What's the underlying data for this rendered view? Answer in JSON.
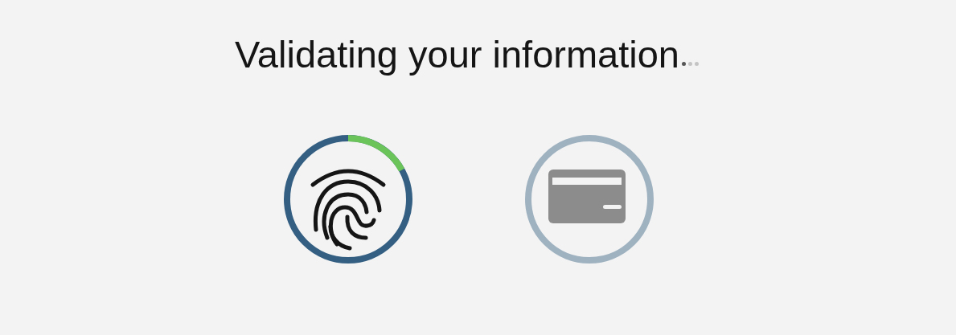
{
  "title": "Validating your information",
  "loading_dots": [
    {
      "selected": true
    },
    {
      "selected": false
    },
    {
      "selected": false
    }
  ],
  "steps": [
    {
      "kind": "fingerprint",
      "active": true
    },
    {
      "kind": "card",
      "active": false
    }
  ]
}
